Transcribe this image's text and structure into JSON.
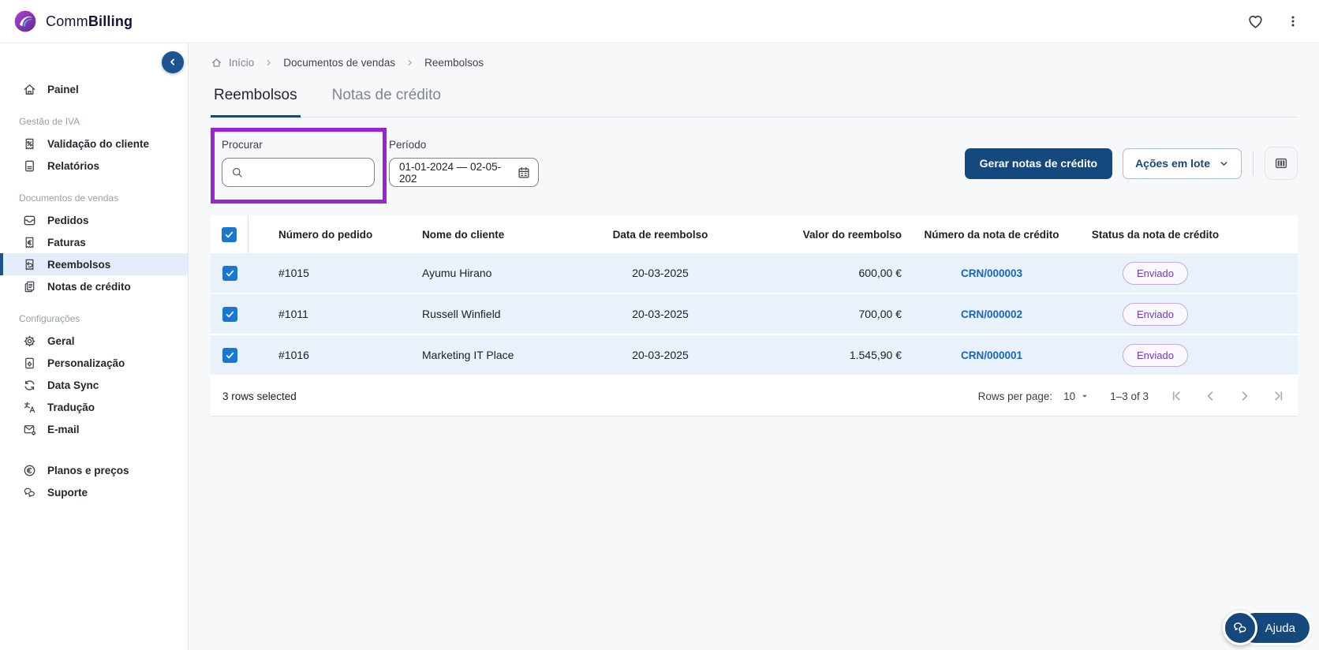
{
  "topbar": {
    "brand": {
      "regular": "Comm",
      "bold": "Billing"
    },
    "icons": [
      "favorite-icon",
      "more-menu-icon"
    ]
  },
  "sidebar": {
    "main_item": {
      "label": "Painel",
      "icon": "home-icon"
    },
    "groups": [
      {
        "title": "Gestão de IVA",
        "items": [
          {
            "label": "Validação do cliente",
            "icon": "receipt-percent-icon"
          },
          {
            "label": "Relatórios",
            "icon": "document-icon"
          }
        ]
      },
      {
        "title": "Documentos de vendas",
        "items": [
          {
            "label": "Pedidos",
            "icon": "inbox-icon"
          },
          {
            "label": "Faturas",
            "icon": "receipt-euro-icon"
          },
          {
            "label": "Reembolsos",
            "icon": "receipt-refund-icon",
            "active": true
          },
          {
            "label": "Notas de crédito",
            "icon": "copy-documents-icon"
          }
        ]
      },
      {
        "title": "Configurações",
        "items": [
          {
            "label": "Geral",
            "icon": "gear-icon"
          },
          {
            "label": "Personalização",
            "icon": "document-gear-icon"
          },
          {
            "label": "Data Sync",
            "icon": "sync-icon"
          },
          {
            "label": "Tradução",
            "icon": "translate-icon"
          },
          {
            "label": "E-mail",
            "icon": "mail-gear-icon"
          }
        ]
      }
    ],
    "footer_items": [
      {
        "label": "Planos e preços",
        "icon": "euro-circle-icon"
      },
      {
        "label": "Suporte",
        "icon": "chat-bubbles-icon"
      }
    ]
  },
  "breadcrumb": {
    "home": "Início",
    "items": [
      "Documentos de vendas",
      "Reembolsos"
    ]
  },
  "tabs": [
    {
      "label": "Reembolsos",
      "active": true
    },
    {
      "label": "Notas de crédito",
      "active": false
    }
  ],
  "filters": {
    "search": {
      "label": "Procurar",
      "placeholder": "",
      "value": ""
    },
    "period": {
      "label": "Período",
      "value": "01-01-2024 — 02-05-202"
    }
  },
  "actions": {
    "generate": "Gerar notas de crédito",
    "batch": "Ações em lote"
  },
  "table": {
    "columns": [
      "Número do pedido",
      "Nome do cliente",
      "Data de reembolso",
      "Valor do reembolso",
      "Número da nota de crédito",
      "Status da nota de crédito"
    ],
    "rows": [
      {
        "order": "#1015",
        "customer": "Ayumu Hirano",
        "date": "20-03-2025",
        "amount": "600,00 €",
        "credit_note": "CRN/000003",
        "status": "Enviado",
        "selected": true
      },
      {
        "order": "#1011",
        "customer": "Russell Winfield",
        "date": "20-03-2025",
        "amount": "700,00 €",
        "credit_note": "CRN/000002",
        "status": "Enviado",
        "selected": true
      },
      {
        "order": "#1016",
        "customer": "Marketing IT Place",
        "date": "20-03-2025",
        "amount": "1.545,90 €",
        "credit_note": "CRN/000001",
        "status": "Enviado",
        "selected": true
      }
    ],
    "footer": {
      "selected_text": "3 rows selected",
      "rows_per_page_label": "Rows per page:",
      "rows_per_page_value": "10",
      "range_text": "1–3 of 3"
    }
  },
  "help": {
    "label": "Ajuda"
  },
  "colors": {
    "primary": "#15497e",
    "highlight_box": "#9c22d6",
    "link": "#1565c0",
    "row_selected_bg": "#e9f1fa",
    "checkbox": "#1976d2",
    "active_item_bg": "#e4eefa",
    "badge_text": "#6d3bbf",
    "badge_border": "#c3a8ea",
    "tab_underline": "#1c4878"
  }
}
